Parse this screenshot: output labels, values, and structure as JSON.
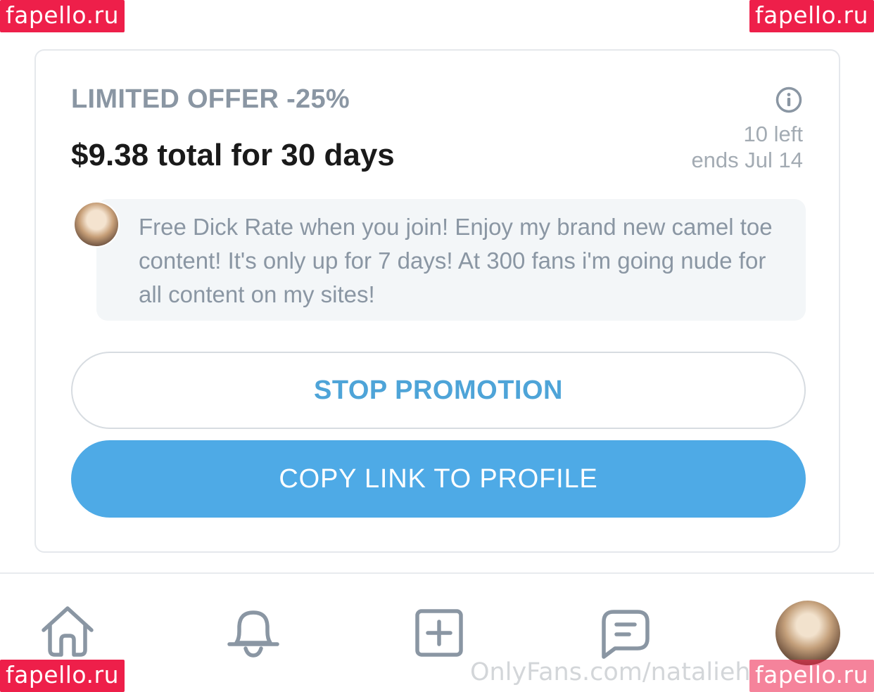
{
  "watermark": "fapello.ru",
  "offer": {
    "title": "LIMITED OFFER -25%",
    "price_line": "$9.38 total for 30 days",
    "remaining": "10 left",
    "ends": "ends Jul 14",
    "message": "Free Dick Rate when you join! Enjoy my brand new camel toe content! It's only up for 7 days! At 300 fans i'm going nude for all content on my sites!"
  },
  "buttons": {
    "stop_label": "STOP PROMOTION",
    "copy_label": "COPY LINK TO PROFILE"
  },
  "footer_url": "OnlyFans.com/natalieh",
  "icons": [
    "info-icon",
    "home-icon",
    "bell-icon",
    "add-post-icon",
    "messages-icon"
  ],
  "colors": {
    "accent": "#4eaae6",
    "accent_text": "#4ea4d8",
    "muted_text": "#8a96a3",
    "watermark_bg": "#ee1f4a"
  }
}
